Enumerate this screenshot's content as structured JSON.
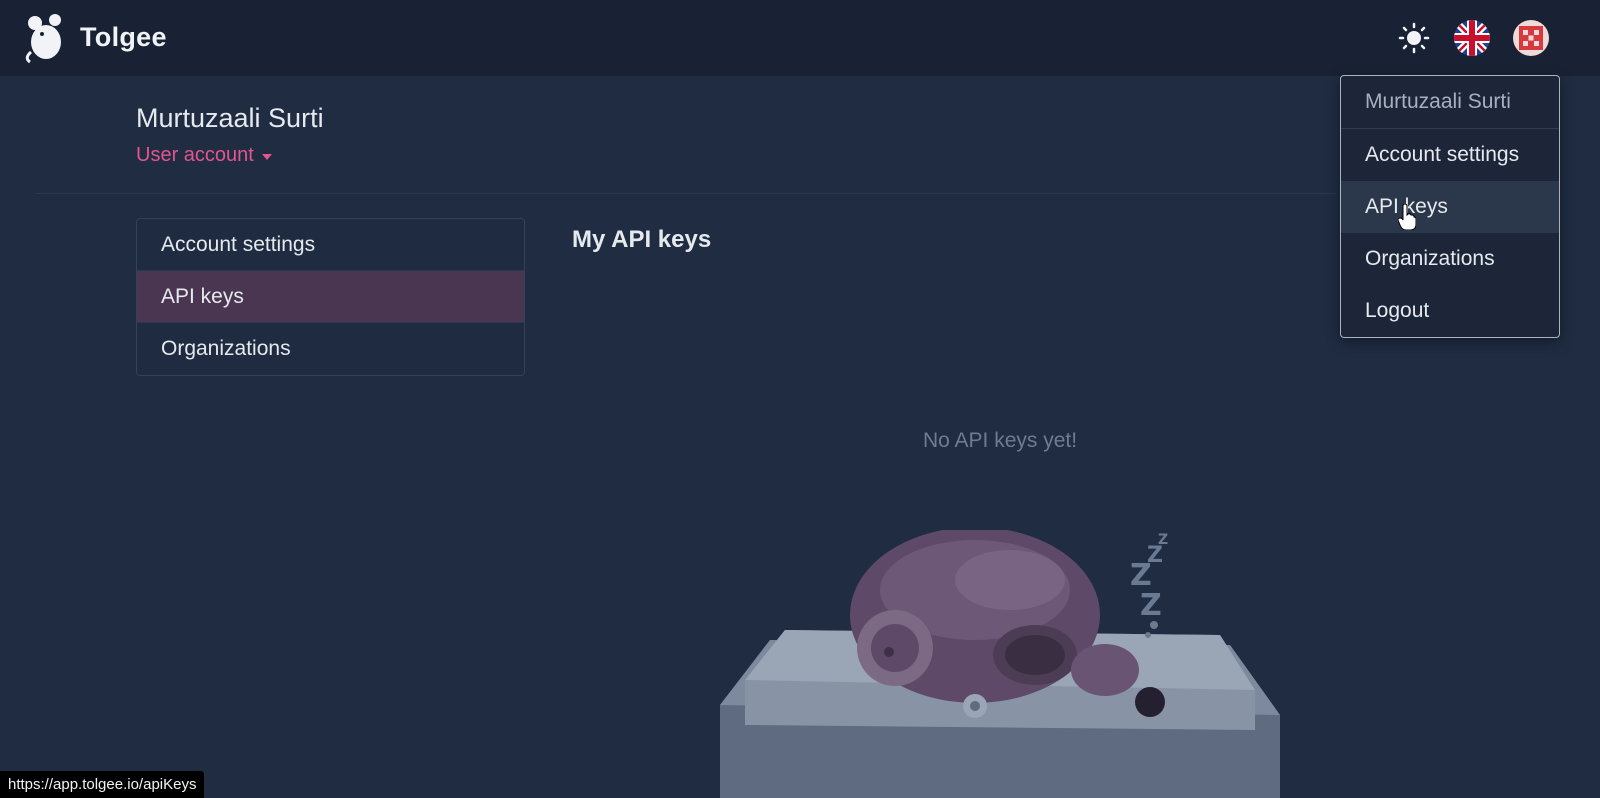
{
  "app": {
    "brand": "Tolgee"
  },
  "topbar": {
    "theme_icon": "sun-icon",
    "language_icon": "uk-flag-icon",
    "avatar_icon": "user-avatar-icon"
  },
  "header": {
    "name": "Murtuzaali Surti",
    "subtitle": "User account"
  },
  "side_menu": {
    "items": [
      {
        "label": "Account settings",
        "active": false
      },
      {
        "label": "API keys",
        "active": true
      },
      {
        "label": "Organizations",
        "active": false
      }
    ]
  },
  "main": {
    "title": "My API keys",
    "empty_message": "No API keys yet!"
  },
  "user_dropdown": {
    "name": "Murtuzaali Surti",
    "items": [
      {
        "label": "Account settings"
      },
      {
        "label": "API keys",
        "hovered": true
      },
      {
        "label": "Organizations"
      },
      {
        "label": "Logout"
      }
    ]
  },
  "status_bar": {
    "url": "https://app.tolgee.io/apiKeys"
  },
  "colors": {
    "background": "#1f2c42",
    "topbar": "#192234",
    "accent": "#e2558e",
    "active_item": "#4a3650"
  }
}
